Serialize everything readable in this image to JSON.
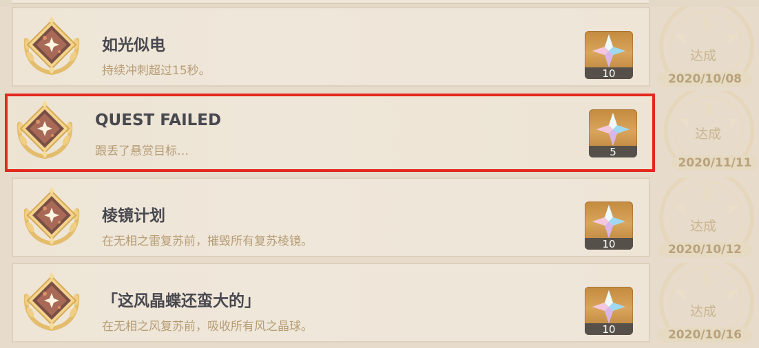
{
  "achievements": [
    {
      "title": "如光似电",
      "description": "持续冲刺超过15秒。",
      "reward_count": "10",
      "status": "达成",
      "date": "2020/10/08"
    },
    {
      "title": "QUEST FAILED",
      "description": "跟丢了悬赏目标…",
      "reward_count": "5",
      "status": "达成",
      "date": "2020/11/11"
    },
    {
      "title": "棱镜计划",
      "description": "在无相之雷复苏前，摧毁所有复苏棱镜。",
      "reward_count": "10",
      "status": "达成",
      "date": "2020/10/12"
    },
    {
      "title": "「这风晶蝶还蛮大的」",
      "description": "在无相之风复苏前，吸收所有风之晶球。",
      "reward_count": "10",
      "status": "达成",
      "date": "2020/10/16"
    }
  ],
  "colors": {
    "highlight_border": "#e3281e",
    "title_text": "#48484f",
    "description_text": "#b69c74",
    "reward_gold": "#d9a45b"
  },
  "icons": {
    "badge": "gold-laurel-badge-icon",
    "reward": "primogem-icon",
    "seal": "completion-seal-icon"
  }
}
